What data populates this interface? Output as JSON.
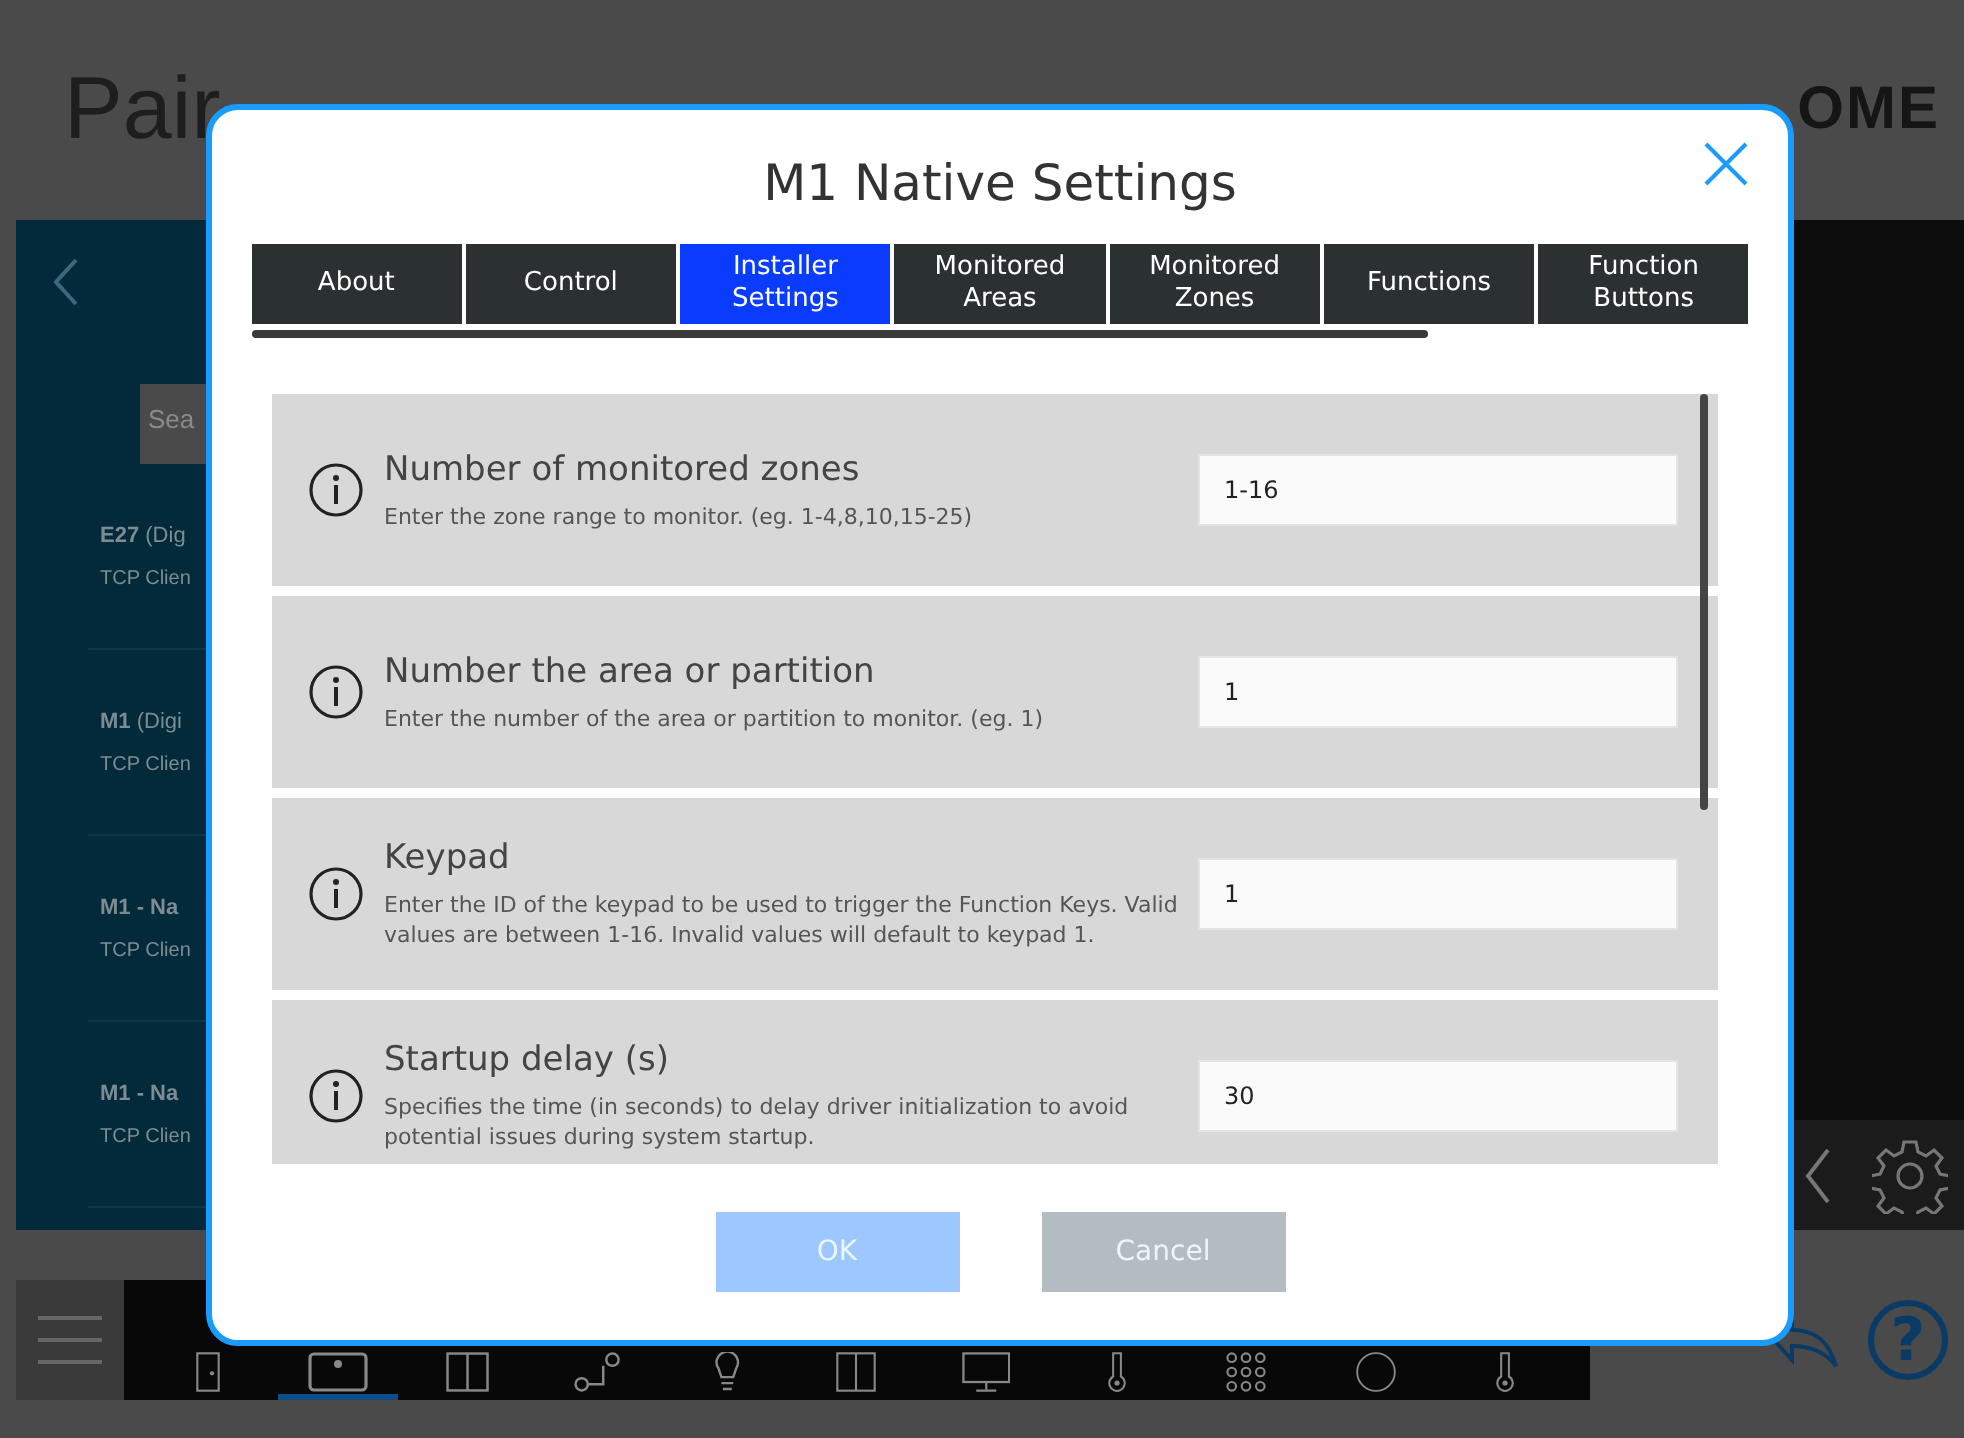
{
  "background": {
    "title": "Pair",
    "brand": "OME",
    "search": {
      "placeholder": "Sea"
    },
    "devices": [
      {
        "name": "E27",
        "detail": "(Dig",
        "subtitle": "TCP Clien"
      },
      {
        "name": "M1",
        "detail": "(Digi",
        "subtitle": "TCP Clien"
      },
      {
        "name": "M1 - Na",
        "subtitle": "TCP Clien"
      },
      {
        "name": "M1 - Na",
        "subtitle": "TCP Clien"
      }
    ],
    "nav": [
      {
        "kind": "door",
        "selected": false
      },
      {
        "kind": "tv",
        "selected": true
      },
      {
        "kind": "cabinet",
        "selected": false
      },
      {
        "kind": "valve",
        "selected": false
      },
      {
        "kind": "bulb",
        "selected": false
      },
      {
        "kind": "window",
        "selected": false
      },
      {
        "kind": "monitor",
        "selected": false
      },
      {
        "kind": "thermostat",
        "selected": false
      },
      {
        "kind": "keypad",
        "selected": false
      },
      {
        "kind": "circle",
        "selected": false
      },
      {
        "kind": "thermostat",
        "selected": false
      }
    ],
    "help": "?"
  },
  "dialog": {
    "title": "M1 Native Settings",
    "tabs": [
      {
        "label": "About",
        "selected": false
      },
      {
        "label": "Control",
        "selected": false
      },
      {
        "label": "Installer Settings",
        "selected": true
      },
      {
        "label": "Monitored Areas",
        "selected": false
      },
      {
        "label": "Monitored Zones",
        "selected": false
      },
      {
        "label": "Functions",
        "selected": false
      },
      {
        "label": "Function Buttons",
        "selected": false
      }
    ],
    "settings": [
      {
        "label": "Number of monitored zones",
        "description": "Enter the zone range to monitor. (eg. 1-4,8,10,15-25)",
        "value": "1-16"
      },
      {
        "label": "Number the area or partition",
        "description": "Enter the number of the area or partition to monitor. (eg. 1)",
        "value": "1"
      },
      {
        "label": "Keypad",
        "description": "Enter the ID of the keypad to be used to trigger the Function Keys. Valid values are between 1-16. Invalid values will default to keypad 1.",
        "value": "1"
      },
      {
        "label": "Startup delay (s)",
        "description": "Specifies the time (in seconds) to delay driver initialization to avoid potential issues during system startup.",
        "value": "30"
      }
    ],
    "buttons": [
      {
        "label": "OK",
        "kind": "primary"
      },
      {
        "label": "Cancel",
        "kind": "secondary"
      }
    ]
  }
}
